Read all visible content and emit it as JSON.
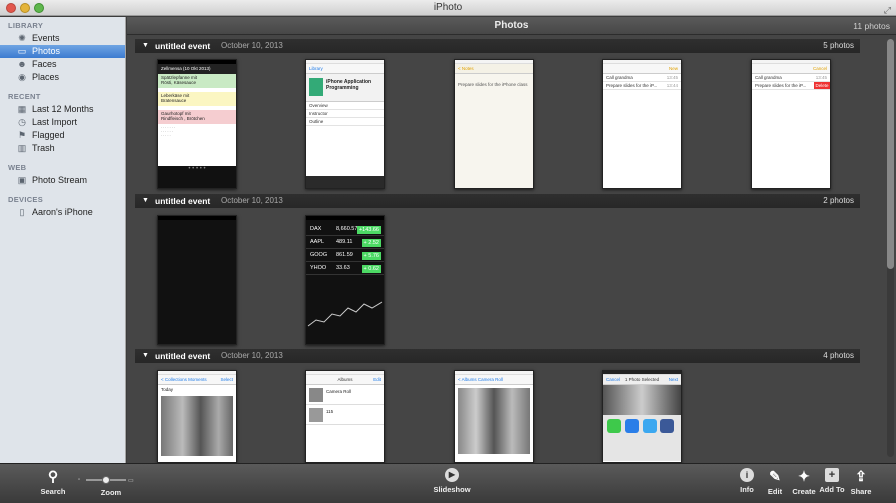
{
  "window": {
    "title": "iPhoto"
  },
  "sidebar": {
    "sections": [
      {
        "heading": "LIBRARY",
        "items": [
          {
            "label": "Events",
            "icon": "events-icon"
          },
          {
            "label": "Photos",
            "icon": "photos-icon",
            "selected": true
          },
          {
            "label": "Faces",
            "icon": "faces-icon"
          },
          {
            "label": "Places",
            "icon": "places-icon"
          }
        ]
      },
      {
        "heading": "RECENT",
        "items": [
          {
            "label": "Last 12 Months",
            "icon": "calendar-icon"
          },
          {
            "label": "Last Import",
            "icon": "clock-icon"
          },
          {
            "label": "Flagged",
            "icon": "flag-icon"
          },
          {
            "label": "Trash",
            "icon": "trash-icon"
          }
        ]
      },
      {
        "heading": "WEB",
        "items": [
          {
            "label": "Photo Stream",
            "icon": "photo-stream-icon"
          }
        ]
      },
      {
        "heading": "DEVICES",
        "items": [
          {
            "label": "Aaron's iPhone",
            "icon": "iphone-icon"
          }
        ]
      }
    ]
  },
  "main": {
    "title": "Photos",
    "count": "11 photos",
    "events": [
      {
        "title": "untitled event",
        "date": "October 10, 2013",
        "count": "5 photos"
      },
      {
        "title": "untitled event",
        "date": "October 10, 2013",
        "count": "2 photos"
      },
      {
        "title": "untitled event",
        "date": "October 10, 2013",
        "count": "4 photos"
      }
    ]
  },
  "thumbs": {
    "menu_header": "Zellmensa (10 Okt 2013)",
    "menu_items": [
      "Spätzlepfanne mit",
      "Rösti, Käsesauce",
      "Leberkäse mit",
      "Bratensauce",
      "Gaurhotopf mit",
      "Rindfleisch , Brötchen"
    ],
    "course_title": "iPhone Application Programming",
    "course_rows": [
      "Overview",
      "Instructor",
      "Outline"
    ],
    "course_nav": "Library",
    "notes_back": "< Notes",
    "notes_text": "Prepare slides for the iPhone class",
    "reminders_new": "New",
    "reminders_cancel": "Cancel",
    "reminders": [
      "Call grandma",
      "Prepare slides for the iP..."
    ],
    "reminder_times": [
      "13:45",
      "13:44"
    ],
    "delete_label": "Delete",
    "stocks": [
      {
        "name": "DAX",
        "price": "8,660.57",
        "change": "+143.66"
      },
      {
        "name": "AAPL",
        "price": "489.11",
        "change": "+ 2.52"
      },
      {
        "name": "GOOG",
        "price": "861.59",
        "change": "+ 5.76"
      },
      {
        "name": "YHOO",
        "price": "33.63",
        "change": "+ 0.62"
      }
    ],
    "moments_nav": "< Collections  Moments",
    "moments_select": "Select",
    "moments_today": "Today",
    "albums_title": "Albums",
    "albums_edit": "Edit",
    "albums_items": [
      "Camera Roll",
      "115"
    ],
    "camera_roll_nav": "< Albums  Camera Roll",
    "share_nav": "1 Photo Selected",
    "share_cancel": "Cancel",
    "share_next": "Next"
  },
  "toolbar": {
    "search": "Search",
    "zoom": "Zoom",
    "slideshow": "Slideshow",
    "info": "Info",
    "edit": "Edit",
    "create": "Create",
    "add_to": "Add To",
    "share": "Share"
  }
}
